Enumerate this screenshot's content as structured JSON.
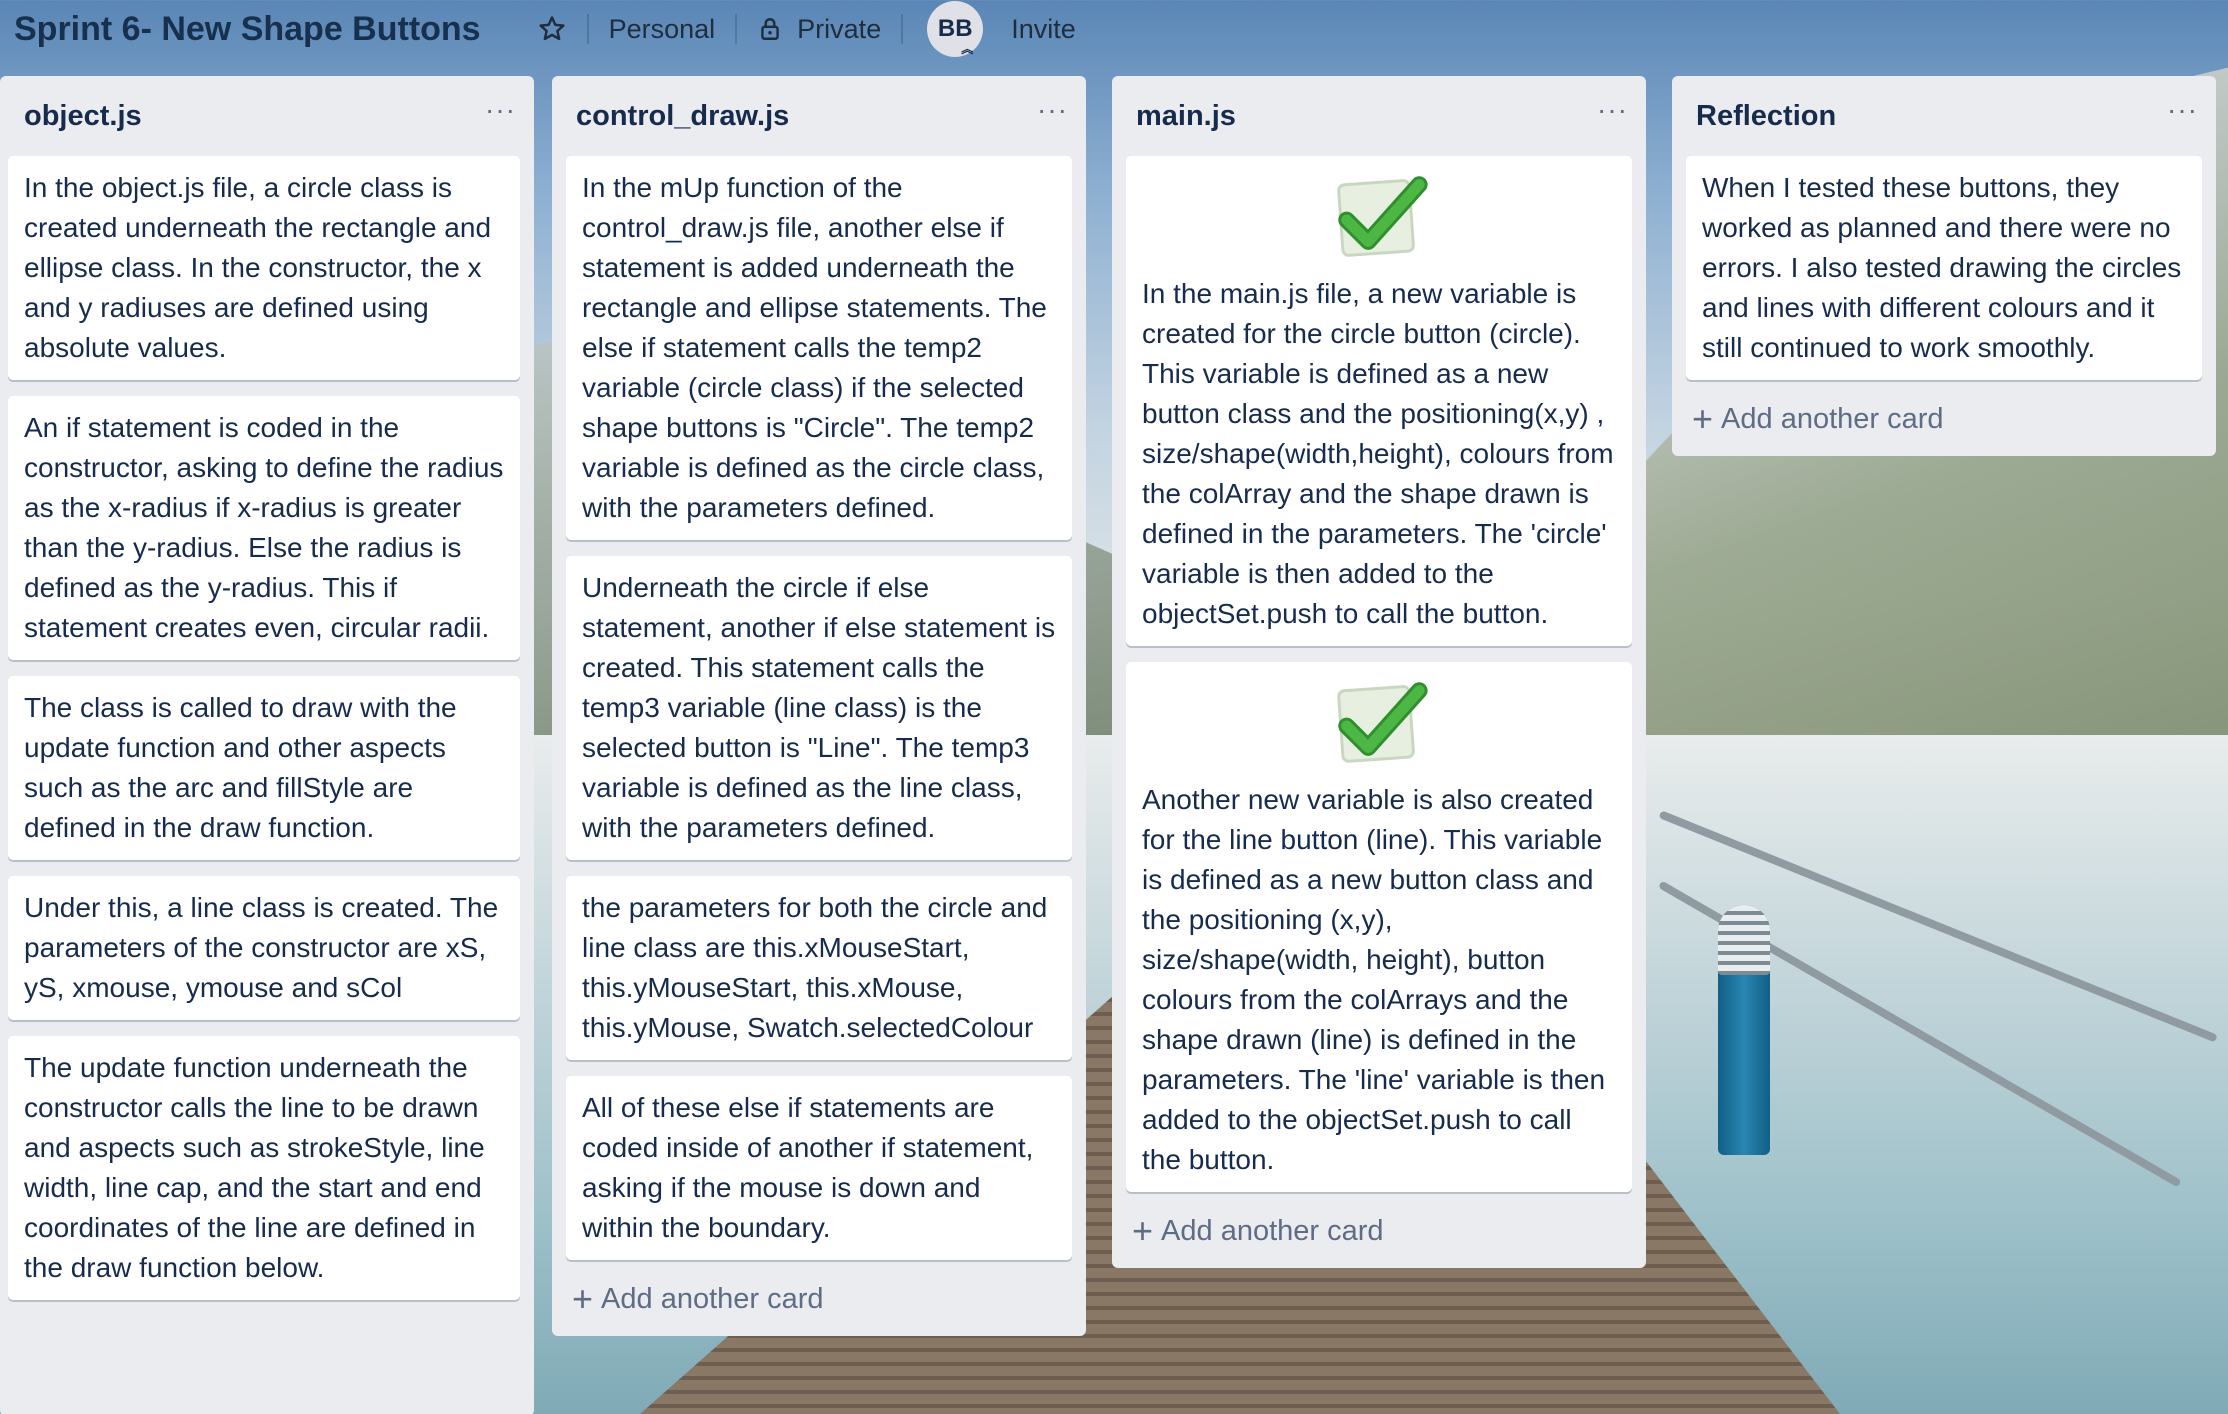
{
  "board": {
    "title": "Sprint 6- New Shape Buttons",
    "visibility_team": "Personal",
    "visibility": "Private",
    "member_initials": "BB",
    "invite_label": "Invite"
  },
  "icons": {
    "star": "star-icon",
    "lock": "lock-icon",
    "checkmark": "checkmark-icon",
    "menu": "more-horizontal-icon",
    "plus": "plus-icon"
  },
  "colors": {
    "list_bg": "#ebecf0",
    "card_bg": "#ffffff",
    "text": "#172b4d",
    "muted": "#5e6c84",
    "check_green": "#3aa635"
  },
  "lists": [
    {
      "title": "object.js",
      "menu": "···",
      "cards": [
        "In the object.js file, a circle class is created underneath the rectangle and ellipse class. In the constructor, the x and y radiuses are defined using absolute values.",
        "An if statement is coded in the constructor, asking to define the radius as the x-radius if x-radius is greater than the y-radius. Else the radius is defined as the y-radius. This if statement creates even, circular radii.",
        "The class is called to draw with the update function and other aspects such as the arc and fillStyle are defined in the draw function.",
        "Under this, a line class is created. The parameters of the constructor are xS, yS, xmouse, ymouse and sCol",
        "The update function underneath the constructor calls the line to be drawn and aspects such as strokeStyle, line width, line cap, and the start and end coordinates of the line are defined in the draw function below."
      ]
    },
    {
      "title": "control_draw.js",
      "menu": "···",
      "cards": [
        "In the mUp function of the control_draw.js file, another else if statement is added underneath the rectangle and ellipse statements. The else if statement calls the temp2 variable (circle class) if the selected shape buttons is \"Circle\". The temp2 variable is defined as the circle class, with the parameters defined.",
        "Underneath the circle if else statement, another if else statement is created. This statement calls the temp3 variable (line class) is the selected button is \"Line\". The temp3 variable is defined as the line class, with the parameters defined.",
        "the parameters for both the circle and line class are this.xMouseStart, this.yMouseStart, this.xMouse, this.yMouse, Swatch.selectedColour",
        "All of these else if statements are coded inside of another if statement, asking if the mouse is down and within the boundary."
      ],
      "add_card": "Add another card"
    },
    {
      "title": "main.js",
      "menu": "···",
      "cards": [
        "In the main.js file, a new variable is created for the circle button (circle). This variable is defined as a new button class and the positioning(x,y) , size/shape(width,height), colours from the colArray and the shape drawn is defined in the parameters. The 'circle' variable is then added to the objectSet.push to call the button.",
        "Another new variable is also created for the line button (line). This variable is defined as a new button class and the positioning (x,y), size/shape(width, height), button colours from the colArrays and the shape drawn (line) is defined in the parameters. The 'line' variable is then added to the objectSet.push to call the button."
      ],
      "add_card": "Add another card"
    },
    {
      "title": "Reflection",
      "menu": "···",
      "cards": [
        "When I tested these buttons, they worked as planned and there were no errors. I also tested drawing the circles and lines with different colours and it still continued to work smoothly."
      ],
      "add_card": "Add another card"
    }
  ]
}
